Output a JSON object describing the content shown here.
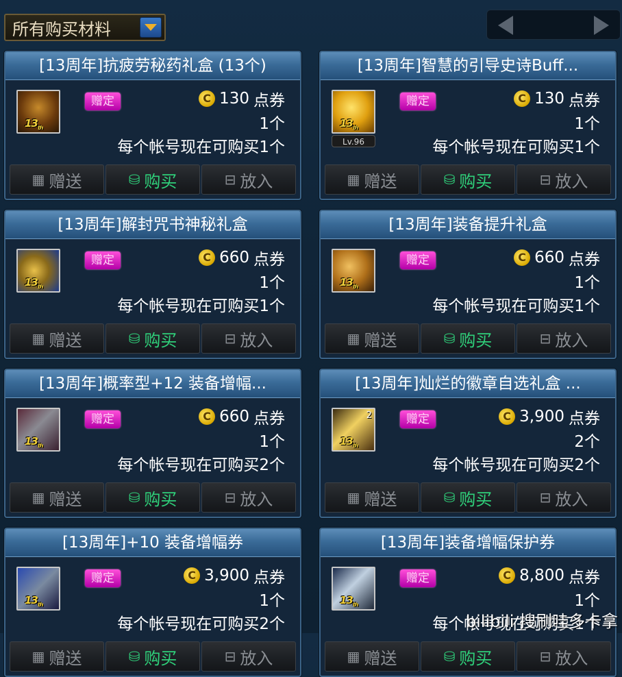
{
  "filter": {
    "label": "所有购买材料"
  },
  "colors": {
    "accent_gold": "#f0b02a",
    "buy_green": "#2fd07a",
    "bound_pink": "#ff4fd9",
    "title_blue": "#3a6b98"
  },
  "buttons": {
    "gift": "赠送",
    "buy": "购买",
    "cart": "放入"
  },
  "bound_label": "赠定",
  "currency_unit": "点券",
  "cards": [
    {
      "title": "[13周年]抗疲劳秘药礼盒 (13个)",
      "price": "130",
      "qty": "1个",
      "limit": "每个帐号现在可购买1个",
      "icon": "potion-box-icon",
      "icon_badge": "13",
      "level": ""
    },
    {
      "title": "[13周年]智慧的引导史诗Buff...",
      "price": "130",
      "qty": "1个",
      "limit": "每个帐号现在可购买1个",
      "icon": "golden-book-icon",
      "icon_badge": "13",
      "level": "Lv.96"
    },
    {
      "title": "[13周年]解封咒书神秘礼盒",
      "price": "660",
      "qty": "1个",
      "limit": "每个帐号现在可购买1个",
      "icon": "scroll-box-icon",
      "icon_badge": "13",
      "level": ""
    },
    {
      "title": "[13周年]装备提升礼盒",
      "price": "660",
      "qty": "1个",
      "limit": "每个帐号现在可购买1个",
      "icon": "gift-sack-icon",
      "icon_badge": "13",
      "level": ""
    },
    {
      "title": "[13周年]概率型+12 装备增幅...",
      "price": "660",
      "qty": "1个",
      "limit": "每个帐号现在可购买2个",
      "icon": "amplify-scroll-icon",
      "icon_badge": "13",
      "level": ""
    },
    {
      "title": "[13周年]灿烂的徽章自选礼盒 ...",
      "price": "3,900",
      "qty": "2个",
      "limit": "每个帐号现在可购买2个",
      "icon": "emblem-box-icon",
      "icon_badge": "13",
      "icon_count": "2",
      "level": ""
    },
    {
      "title": "[13周年]+10 装备增幅券",
      "price": "3,900",
      "qty": "1个",
      "limit": "每个帐号现在可购买2个",
      "icon": "plus10-ticket-icon",
      "icon_badge": "13",
      "level": ""
    },
    {
      "title": "[13周年]装备增幅保护券",
      "price": "8,800",
      "qty": "1个",
      "limit": "每个帐号现在可购买1个",
      "icon": "protect-ticket-icon",
      "icon_badge": "13",
      "level": ""
    }
  ],
  "watermark": "bilibili 搜刷哇多卡拿"
}
